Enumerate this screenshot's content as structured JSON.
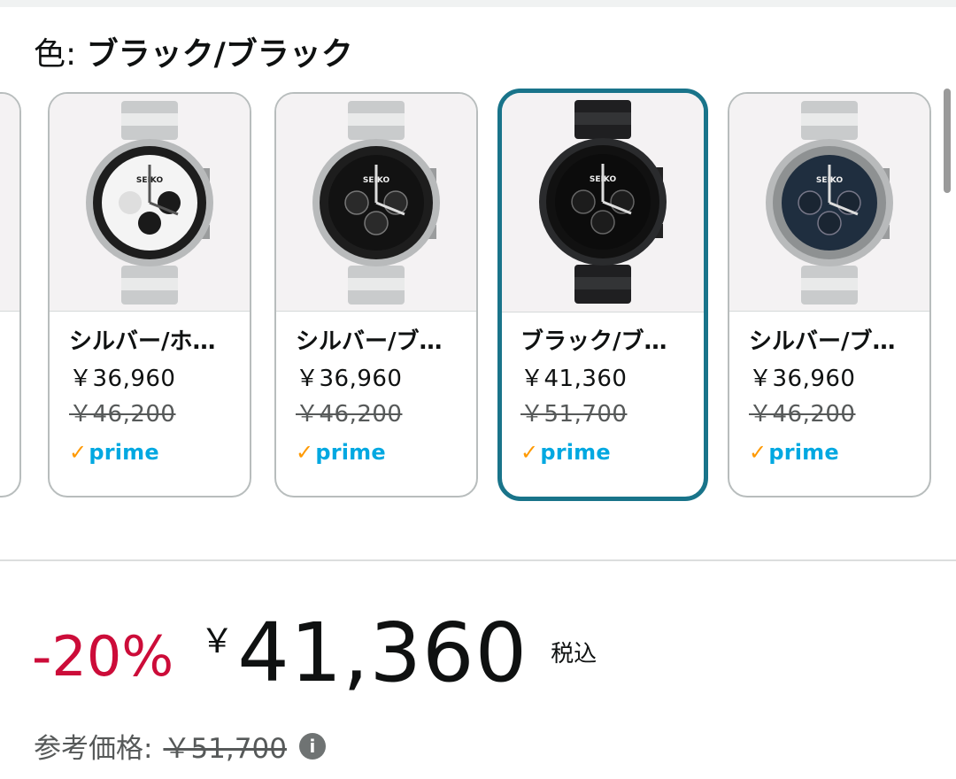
{
  "color_selector": {
    "label": "色:",
    "selected_value": "ブラック/ブラック"
  },
  "variants": [
    {
      "name": "シルバー/ホ…",
      "price": "￥36,960",
      "list_price": "￥46,200",
      "prime": "prime",
      "dial": "white"
    },
    {
      "name": "シルバー/ブ…",
      "price": "￥36,960",
      "list_price": "￥46,200",
      "prime": "prime",
      "dial": "black"
    },
    {
      "name": "ブラック/ブ…",
      "price": "￥41,360",
      "list_price": "￥51,700",
      "prime": "prime",
      "dial": "black-case",
      "selected": true
    },
    {
      "name": "シルバー/ブ…",
      "price": "￥36,960",
      "list_price": "￥46,200",
      "prime": "prime",
      "dial": "blue"
    }
  ],
  "price_block": {
    "discount": "-20%",
    "currency_symbol": "￥",
    "amount": "41,360",
    "tax_note": "税込",
    "reference_label": "参考価格:",
    "reference_price": "￥51,700",
    "info_icon": "i"
  },
  "colors": {
    "selected_border": "#19748a",
    "discount": "#cc0c39",
    "prime_blue": "#00a8e1",
    "prime_check": "#ff9900"
  }
}
